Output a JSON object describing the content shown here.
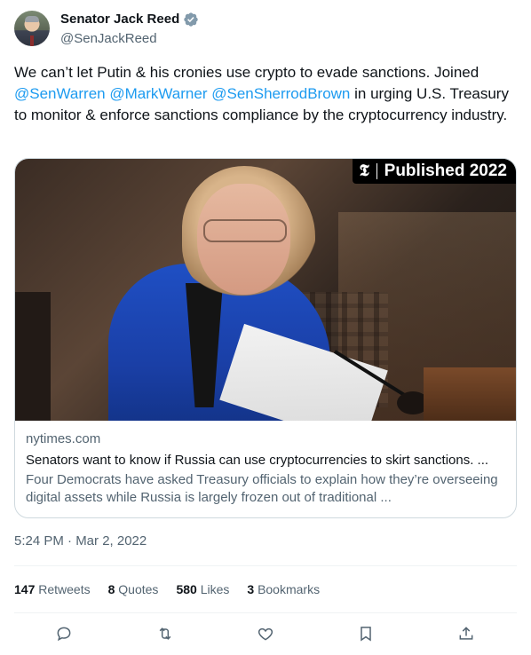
{
  "author": {
    "display_name": "Senator Jack Reed",
    "handle": "@SenJackReed",
    "verified_icon": "verified-badge-icon"
  },
  "tweet": {
    "text_start": "We can’t let Putin & his cronies use crypto to evade sanctions. Joined ",
    "mention_1": "@SenWarren",
    "mention_2": "@MarkWarner",
    "mention_3": "@SenSherrodBrown",
    "text_end": " in urging U.S. Treasury to monitor & enforce sanctions compliance by the cryptocurrency industry."
  },
  "card": {
    "badge_logo": "𝕿",
    "badge_text": "Published 2022",
    "domain": "nytimes.com",
    "title": "Senators want to know if Russia can use cryptocurrencies to skirt sanctions. ...",
    "description": "Four Democrats have asked Treasury officials to explain how they’re overseeing digital assets while Russia is largely frozen out of traditional ..."
  },
  "timestamp": "5:24 PM · Mar 2, 2022",
  "stats": {
    "retweets_count": "147",
    "retweets_label": "Retweets",
    "quotes_count": "8",
    "quotes_label": "Quotes",
    "likes_count": "580",
    "likes_label": "Likes",
    "bookmarks_count": "3",
    "bookmarks_label": "Bookmarks"
  },
  "actions": [
    "reply-icon",
    "retweet-icon",
    "like-icon",
    "bookmark-icon",
    "share-icon"
  ],
  "colors": {
    "accent": "#1d9bf0",
    "secondary_text": "#536471",
    "primary_text": "#0f1419",
    "jacket_blue": "#1f4fc4"
  }
}
